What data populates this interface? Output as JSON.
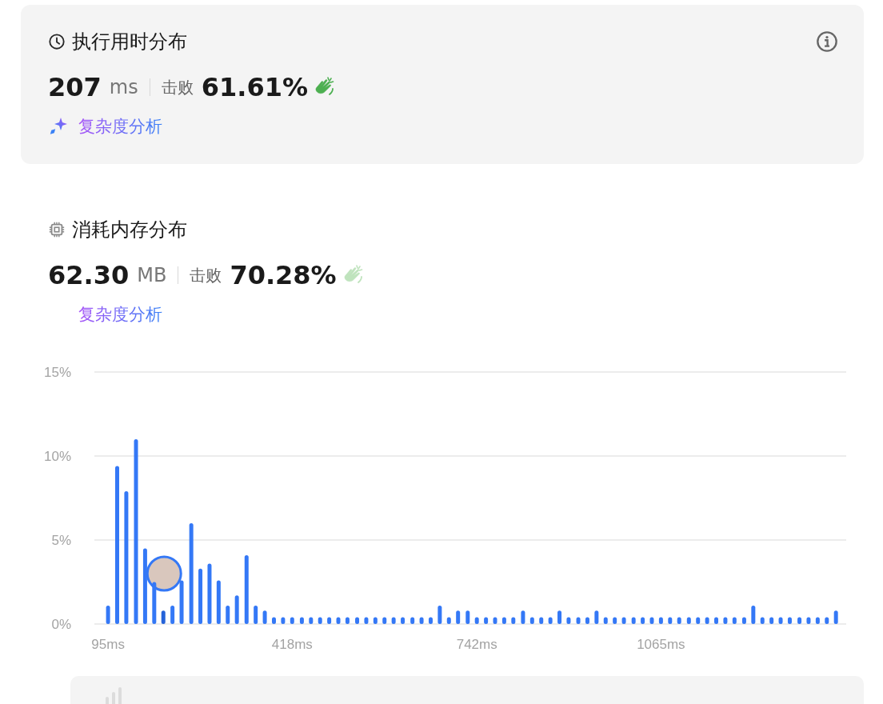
{
  "sections": [
    {
      "kind": "runtime",
      "selected": true,
      "title": "执行用时分布",
      "value": "207",
      "unit": "ms",
      "beats_label": "击败",
      "beats": "61.61%",
      "analysis_link": "复杂度分析"
    },
    {
      "kind": "memory",
      "selected": false,
      "title": "消耗内存分布",
      "value": "62.30",
      "unit": "MB",
      "beats_label": "击败",
      "beats": "70.28%",
      "analysis_link": "复杂度分析"
    }
  ],
  "chart_data": {
    "type": "bar",
    "ylim": [
      0,
      15
    ],
    "yticks": [
      {
        "value": 0,
        "label": "0%"
      },
      {
        "value": 5,
        "label": "5%"
      },
      {
        "value": 10,
        "label": "10%"
      },
      {
        "value": 15,
        "label": "15%"
      }
    ],
    "x": [
      95,
      111,
      127,
      144,
      160,
      176,
      192,
      208,
      224,
      241,
      257,
      273,
      289,
      305,
      321,
      338,
      354,
      370,
      386,
      402,
      418,
      435,
      451,
      467,
      483,
      499,
      515,
      532,
      548,
      564,
      580,
      596,
      612,
      629,
      645,
      661,
      677,
      693,
      709,
      726,
      742,
      758,
      774,
      790,
      806,
      823,
      839,
      855,
      871,
      887,
      903,
      920,
      936,
      952,
      968,
      984,
      1000,
      1017,
      1033,
      1049,
      1065,
      1081,
      1097,
      1114,
      1130,
      1146,
      1162,
      1178,
      1194,
      1211,
      1227,
      1243,
      1259,
      1275,
      1291,
      1308,
      1324,
      1340,
      1356,
      1372
    ],
    "xlim": [
      71,
      1390
    ],
    "xticks": [
      {
        "value": 95,
        "label": "95ms"
      },
      {
        "value": 418,
        "label": "418ms"
      },
      {
        "value": 742,
        "label": "742ms"
      },
      {
        "value": 1065,
        "label": "1065ms"
      }
    ],
    "values": [
      1.1,
      9.4,
      7.9,
      11.0,
      4.5,
      2.5,
      0.8,
      1.1,
      2.6,
      6.0,
      3.3,
      3.6,
      2.6,
      1.1,
      1.7,
      4.1,
      1.1,
      0.8,
      0.4,
      0.4,
      0.4,
      0.4,
      0.4,
      0.4,
      0.4,
      0.4,
      0.4,
      0.4,
      0.4,
      0.4,
      0.4,
      0.4,
      0.4,
      0.4,
      0.4,
      0.4,
      1.1,
      0.4,
      0.8,
      0.8,
      0.4,
      0.4,
      0.4,
      0.4,
      0.4,
      0.8,
      0.4,
      0.4,
      0.4,
      0.8,
      0.4,
      0.4,
      0.4,
      0.8,
      0.4,
      0.4,
      0.4,
      0.4,
      0.4,
      0.4,
      0.4,
      0.4,
      0.4,
      0.4,
      0.4,
      0.4,
      0.4,
      0.4,
      0.4,
      0.4,
      1.1,
      0.4,
      0.4,
      0.4,
      0.4,
      0.4,
      0.4,
      0.4,
      0.4,
      0.8
    ]
  }
}
